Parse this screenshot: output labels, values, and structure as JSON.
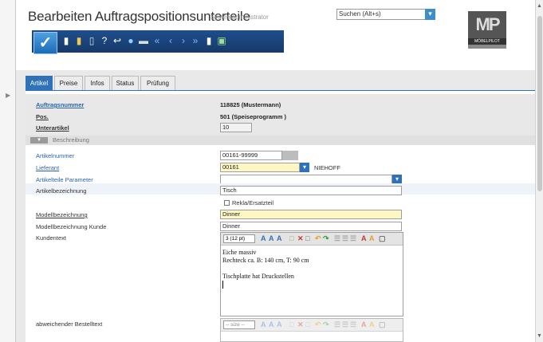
{
  "header": {
    "title": "Bearbeiten Auftragspositionsunterteile",
    "user": "Systemadministrator",
    "search_placeholder": "Suchen (Alt+s)",
    "logo_text": "MP",
    "logo_brand": "MÖBELPILOT"
  },
  "toolbar": {
    "icons": [
      "ok-check-icon",
      "new-document-icon",
      "copy-document-icon",
      "delete-trash-icon",
      "help-question-icon",
      "back-arrow-icon",
      "search-zoom-icon",
      "print-icon",
      "first-record-icon",
      "previous-record-icon",
      "next-record-icon",
      "last-record-icon",
      "report-icon",
      "image-icon"
    ]
  },
  "tabs": [
    {
      "label": "Artikel",
      "active": true
    },
    {
      "label": "Preise",
      "active": false
    },
    {
      "label": "Infos",
      "active": false
    },
    {
      "label": "Status",
      "active": false
    },
    {
      "label": "Prüfung",
      "active": false
    }
  ],
  "form": {
    "auftragsnummer_label": "Auftragsnummer",
    "auftragsnummer_value": "118825 (Mustermann)",
    "pos_label": "Pos.",
    "pos_value": "501 (Speiseprogramm )",
    "unterartikel_label": "Unterartikel",
    "unterartikel_value": "10",
    "section_title": "Beschreibung",
    "artikelnummer_label": "Artikelnummer",
    "artikelnummer_value": "00161-99999",
    "lieferant_label": "Lieferant",
    "lieferant_value": "00161",
    "lieferant_name": "NIEHOFF",
    "parameter_label": "Artikelteile Parameter",
    "parameter_value": "",
    "bezeichnung_label": "Artikelbezeichnung",
    "bezeichnung_value": "Tisch",
    "rekla_label": "Rekla/Ersatzteil",
    "modell_label": "Modellbezeichnung",
    "modell_value": "Dinner",
    "modell_kunde_label": "Modellbezeichnung Kunde",
    "modell_kunde_value": "Dinner",
    "kundentext_label": "Kundentext",
    "editor_size": "3 (12 pt)",
    "kundentext_line1": "Eiche massiv",
    "kundentext_line2": "Rechteck ca. B: 140 cm, T: 90 cm",
    "kundentext_line3": "Tischplatte hat Druckstellen",
    "bestelltext_label": "abweichender Bestelltext",
    "editor2_size": "-- size --"
  },
  "colors": {
    "accent": "#2f72b9",
    "toolbar": "#1f4e8c",
    "highlight": "#fdf7c3"
  }
}
